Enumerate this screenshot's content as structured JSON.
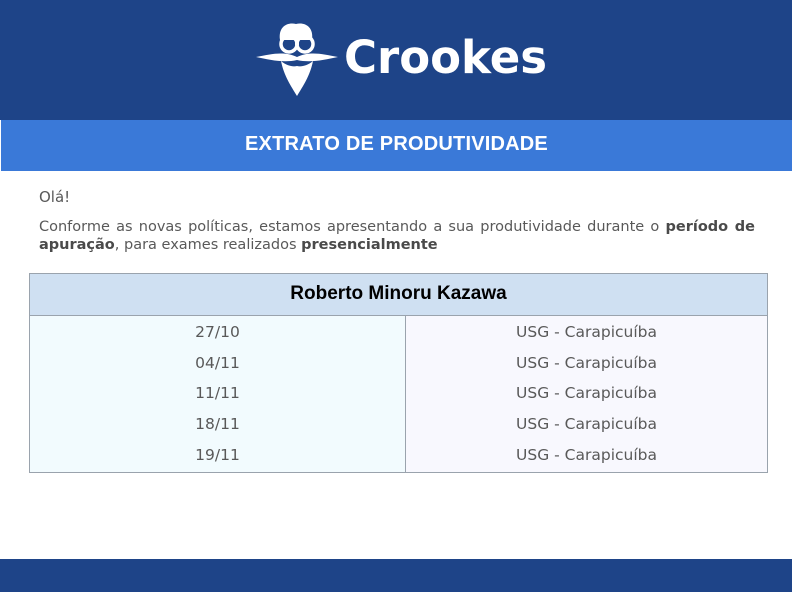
{
  "header": {
    "brand": "Crookes",
    "colors": {
      "primary": "#1e4488",
      "accent": "#3a79d8"
    },
    "logo_icon": "bearded-scientist-mascot-icon"
  },
  "title_band": {
    "title": "EXTRATO DE PRODUTIVIDADE"
  },
  "message": {
    "greeting": "Olá!",
    "intro_part1": "Conforme as novas políticas, estamos apresentando a sua produtividade durante o ",
    "intro_bold1": "período de apuração",
    "intro_part2": ", para exames realizados ",
    "intro_bold2": "presencialmente"
  },
  "table": {
    "name": "Roberto Minoru Kazawa",
    "rows": [
      {
        "date": "27/10",
        "place": "USG - Carapicuíba"
      },
      {
        "date": "04/11",
        "place": "USG - Carapicuíba"
      },
      {
        "date": "11/11",
        "place": "USG - Carapicuíba"
      },
      {
        "date": "18/11",
        "place": "USG - Carapicuíba"
      },
      {
        "date": "19/11",
        "place": "USG - Carapicuíba"
      }
    ]
  }
}
